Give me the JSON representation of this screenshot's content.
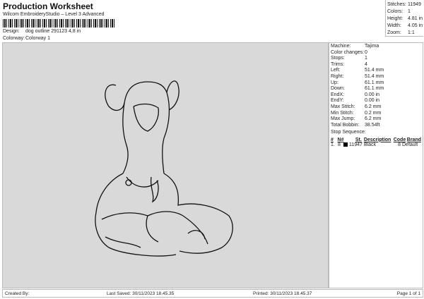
{
  "header": {
    "title": "Production Worksheet",
    "subtitle": "Wilcom EmbroideryStudio – Level 3 Advanced",
    "design_label": "Design:",
    "design_value": "dog outline 291123 4,8 in",
    "colorway_label": "Colorway:",
    "colorway_value": "Colorway 1"
  },
  "stats": [
    {
      "k": "Stitches:",
      "v": "11949"
    },
    {
      "k": "Colors:",
      "v": "1"
    },
    {
      "k": "Height:",
      "v": "4.81 in"
    },
    {
      "k": "Width:",
      "v": "4.05 in"
    },
    {
      "k": "Zoom:",
      "v": "1:1"
    }
  ],
  "details": [
    {
      "k": "Machine:",
      "v": "Tajima"
    },
    {
      "k": "Color changes:",
      "v": "0"
    },
    {
      "k": "Stops:",
      "v": "1"
    },
    {
      "k": "Trims:",
      "v": "4"
    },
    {
      "k": "Left:",
      "v": "51.4 mm"
    },
    {
      "k": "Right:",
      "v": "51.4 mm"
    },
    {
      "k": "Up:",
      "v": "61.1 mm"
    },
    {
      "k": "Down:",
      "v": "61.1 mm"
    },
    {
      "k": "EndX:",
      "v": "0.00 in"
    },
    {
      "k": "EndY:",
      "v": "0.00 in"
    },
    {
      "k": "Max Stitch:",
      "v": "6.2 mm"
    },
    {
      "k": "Min Stitch:",
      "v": "0.2 mm"
    },
    {
      "k": "Max Jump:",
      "v": "6.2 mm"
    },
    {
      "k": "Total Bobbin:",
      "v": "38.54ft"
    }
  ],
  "stop_sequence": {
    "label": "Stop Sequence:",
    "headers": [
      "#",
      "N#",
      "St.",
      "Description",
      "Code",
      "Brand"
    ],
    "rows": [
      {
        "num": "1.",
        "n": "8",
        "color": "#000000",
        "st": "11947",
        "desc": "Black",
        "code": "8",
        "brand": "Default"
      }
    ]
  },
  "footer": {
    "created": "Created By:",
    "saved": "Last Saved: 30/11/2023 18.45.35",
    "printed": "Printed: 30/11/2023 18.45.37",
    "page": "Page 1 of 1"
  }
}
